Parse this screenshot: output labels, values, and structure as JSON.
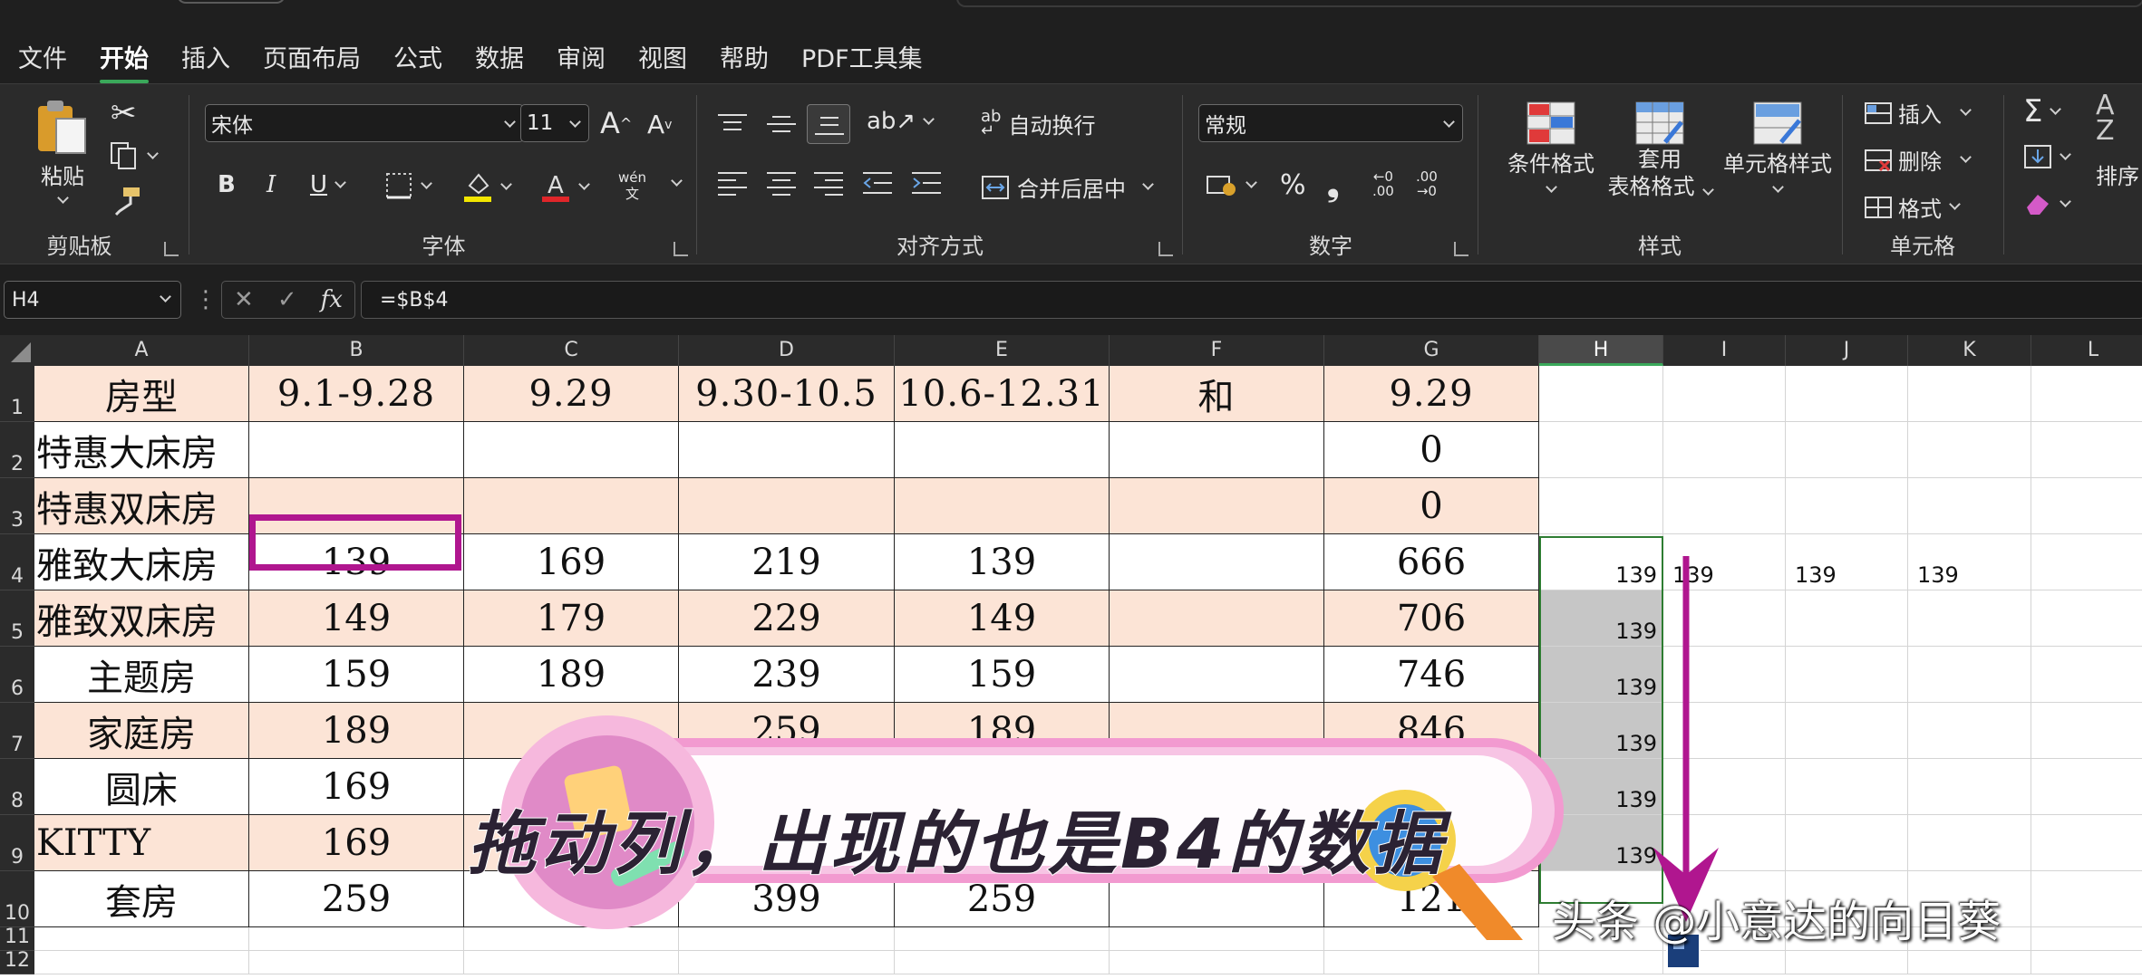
{
  "menu": {
    "tabs": [
      {
        "label": "文件",
        "active": false
      },
      {
        "label": "开始",
        "active": true
      },
      {
        "label": "插入",
        "active": false
      },
      {
        "label": "页面布局",
        "active": false
      },
      {
        "label": "公式",
        "active": false
      },
      {
        "label": "数据",
        "active": false
      },
      {
        "label": "审阅",
        "active": false
      },
      {
        "label": "视图",
        "active": false
      },
      {
        "label": "帮助",
        "active": false
      },
      {
        "label": "PDF工具集",
        "active": false
      }
    ]
  },
  "ribbon": {
    "clipboard": {
      "paste": "粘贴",
      "label": "剪贴板"
    },
    "font": {
      "name": "宋体",
      "size": "11",
      "phonetic": "wén",
      "label": "字体",
      "bold": "B",
      "italic": "I",
      "underline": "U",
      "grow": "A",
      "shrink": "A"
    },
    "alignment": {
      "wrap": "自动换行",
      "merge": "合并后居中",
      "label": "对齐方式",
      "ab": "ab"
    },
    "number": {
      "format": "常规",
      "label": "数字",
      "percent": "%",
      "comma": "❟"
    },
    "styles": {
      "conditional": "条件格式",
      "table_line1": "套用",
      "table_line2": "表格格式",
      "cell_styles": "单元格样式",
      "label": "样式"
    },
    "cells": {
      "insert": "插入",
      "delete": "删除",
      "format": "格式",
      "label": "单元格"
    },
    "editing": {
      "sort": "排序",
      "sum": "Σ"
    }
  },
  "formula_bar": {
    "name_box": "H4",
    "formula": "=$B$4",
    "fx": "fx"
  },
  "sheet": {
    "columns": [
      "A",
      "B",
      "C",
      "D",
      "E",
      "F",
      "G",
      "H",
      "I",
      "J",
      "K",
      "L"
    ],
    "rows": [
      "1",
      "2",
      "3",
      "4",
      "5",
      "6",
      "7",
      "8",
      "9",
      "10",
      "11",
      "12"
    ],
    "table": [
      [
        "房型",
        "9.1-9.28",
        "9.29",
        "9.30-10.5",
        "10.6-12.31",
        "和",
        "9.29"
      ],
      [
        "特惠大床房",
        "",
        "",
        "",
        "",
        "",
        "0"
      ],
      [
        "特惠双床房",
        "",
        "",
        "",
        "",
        "",
        "0"
      ],
      [
        "雅致大床房",
        "139",
        "169",
        "219",
        "139",
        "",
        "666"
      ],
      [
        "雅致双床房",
        "149",
        "179",
        "229",
        "149",
        "",
        "706"
      ],
      [
        "主题房",
        "159",
        "189",
        "239",
        "159",
        "",
        "746"
      ],
      [
        "家庭房",
        "189",
        "",
        "259",
        "189",
        "",
        "846"
      ],
      [
        "圆床",
        "169",
        "",
        "",
        "",
        "",
        ""
      ],
      [
        "KITTY",
        "169",
        "",
        "",
        "",
        "",
        ""
      ],
      [
        "套房",
        "259",
        "",
        "399",
        "259",
        "",
        "121"
      ]
    ],
    "fill_values": {
      "H4": "139",
      "H5": "139",
      "H6": "139",
      "H7": "139",
      "H8": "139",
      "H9": "139",
      "I4": "139",
      "J4": "139",
      "K4": "139"
    }
  },
  "annotation": {
    "caption": "拖动列，出现的也是B4的数据"
  },
  "watermark": "头条 @小意达的向日葵",
  "colors": {
    "accent_green": "#3aa85a",
    "row_highlight": "#fce4d6",
    "magenta": "#b0168f",
    "selection_gray": "#c6c6c6",
    "banner_pink": "#f6b8dd"
  }
}
